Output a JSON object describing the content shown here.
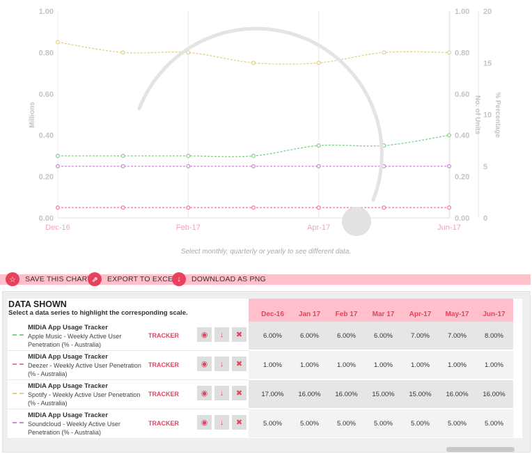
{
  "chart_data": {
    "type": "line",
    "x": [
      "Dec-16",
      "Jan-17",
      "Feb-17",
      "Mar-17",
      "Apr-17",
      "May-17",
      "Jun-17"
    ],
    "x_tick_labels": [
      "Dec-16",
      "Feb-17",
      "Apr-17",
      "Jun-17"
    ],
    "xlabel": "",
    "y_axes": [
      {
        "label": "Millions",
        "ticks": [
          "0.00",
          "0.20",
          "0.40",
          "0.60",
          "0.80",
          "1.00"
        ],
        "range": [
          0,
          1
        ]
      },
      {
        "label": "No. of Units",
        "ticks": [
          "0.00",
          "0.20",
          "0.40",
          "0.60",
          "0.80",
          "1.00"
        ],
        "range": [
          0,
          1
        ]
      },
      {
        "label": "% Percentage",
        "ticks": [
          "0",
          "5",
          "10",
          "15",
          "20"
        ],
        "range": [
          0,
          20
        ]
      }
    ],
    "series": [
      {
        "name": "Apple Music - Weekly Active User Penetration (% - Australia)",
        "color": "#7ed08a",
        "values": [
          6,
          6,
          6,
          6,
          7,
          7,
          8
        ]
      },
      {
        "name": "Deezer - Weekly Active User Penetration (% - Australia)",
        "color": "#ef7a9c",
        "values": [
          1,
          1,
          1,
          1,
          1,
          1,
          1
        ]
      },
      {
        "name": "Spotify - Weekly Active User Penetration (% - Australia)",
        "color": "#e3cf82",
        "values": [
          17,
          16,
          16,
          15,
          15,
          16,
          16
        ]
      },
      {
        "name": "Soundcloud - Weekly Active User Penetration (% - Australia)",
        "color": "#c78ad6",
        "values": [
          5,
          5,
          5,
          5,
          5,
          5,
          5
        ]
      }
    ],
    "grid": true
  },
  "caption": "Select monthly, quarterly or yearly to see different data.",
  "toolbar": {
    "save": "SAVE THIS CHART",
    "export": "EXPORT TO EXCEL",
    "download": "DOWNLOAD AS PNG"
  },
  "table": {
    "title": "DATA SHOWN",
    "subtitle": "Select a data series to highlight the corresponding scale.",
    "months": [
      "Dec-16",
      "Jan 17",
      "Feb 17",
      "Mar 17",
      "Apr-17",
      "May-17",
      "Jun-17"
    ],
    "tracker_label": "TRACKER",
    "rows": [
      {
        "source": "MIDiA App Usage Tracker",
        "desc": "Apple Music - Weekly Active User Penetration (% - Australia)",
        "color": "#7ed08a",
        "values": [
          "6.00%",
          "6.00%",
          "6.00%",
          "6.00%",
          "7.00%",
          "7.00%",
          "8.00%"
        ]
      },
      {
        "source": "MIDiA App Usage Tracker",
        "desc": "Deezer - Weekly Active User Penetration (% - Australia)",
        "color": "#ef7a9c",
        "values": [
          "1.00%",
          "1.00%",
          "1.00%",
          "1.00%",
          "1.00%",
          "1.00%",
          "1.00%"
        ]
      },
      {
        "source": "MIDiA App Usage Tracker",
        "desc": "Spotify - Weekly Active User Penetration (% - Australia)",
        "color": "#e3cf82",
        "values": [
          "17.00%",
          "16.00%",
          "16.00%",
          "15.00%",
          "15.00%",
          "16.00%",
          "16.00%"
        ]
      },
      {
        "source": "MIDiA App Usage Tracker",
        "desc": "Soundcloud - Weekly Active User Penetration (% - Australia)",
        "color": "#c78ad6",
        "values": [
          "5.00%",
          "5.00%",
          "5.00%",
          "5.00%",
          "5.00%",
          "5.00%",
          "5.00%"
        ]
      }
    ]
  },
  "colors": {
    "accent": "#e8415e",
    "highlight": "#ffc0cb"
  },
  "icons": {
    "save": "star-icon",
    "export": "export-icon",
    "download": "download-icon",
    "view": "eye-icon",
    "row_download": "download-icon",
    "remove": "close-icon"
  }
}
